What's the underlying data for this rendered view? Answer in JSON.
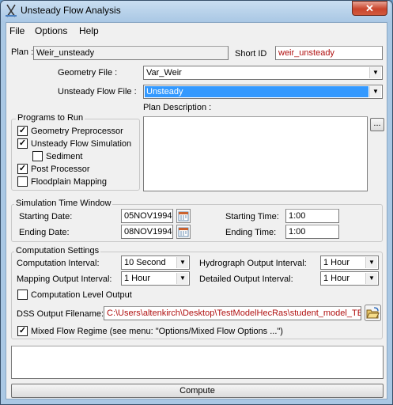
{
  "window": {
    "title": "Unsteady Flow Analysis",
    "close": "✕"
  },
  "menu": [
    "File",
    "Options",
    "Help"
  ],
  "plan": {
    "label": "Plan :",
    "value": "Weir_unsteady",
    "short_id_label": "Short ID",
    "short_id_value": "weir_unsteady"
  },
  "geometry": {
    "label": "Geometry File :",
    "value": "Var_Weir"
  },
  "unsteady_file": {
    "label": "Unsteady Flow File :",
    "value": "Unsteady"
  },
  "programs": {
    "title": "Programs to Run",
    "items": [
      {
        "label": "Geometry Preprocessor",
        "checked": true
      },
      {
        "label": "Unsteady Flow Simulation",
        "checked": true
      },
      {
        "label": "Sediment",
        "checked": false
      },
      {
        "label": "Post Processor",
        "checked": true
      },
      {
        "label": "Floodplain Mapping",
        "checked": false
      }
    ]
  },
  "plan_description": {
    "label": "Plan Description :",
    "value": "",
    "button": "..."
  },
  "sim_window": {
    "title": "Simulation Time Window",
    "start_date_label": "Starting Date:",
    "start_date": "05NOV1994",
    "end_date_label": "Ending Date:",
    "end_date": "08NOV1994",
    "start_time_label": "Starting Time:",
    "start_time": "1:00",
    "end_time_label": "Ending Time:",
    "end_time": "1:00"
  },
  "computation": {
    "title": "Computation Settings",
    "comp_interval_label": "Computation Interval:",
    "comp_interval": "10 Second",
    "hydro_interval_label": "Hydrograph Output Interval:",
    "hydro_interval": "1 Hour",
    "map_interval_label": "Mapping Output Interval:",
    "map_interval": "1 Hour",
    "detail_interval_label": "Detailed Output Interval:",
    "detail_interval": "1 Hour",
    "comp_level_label": "Computation Level Output",
    "comp_level_checked": false,
    "dss_label": "DSS Output Filename:",
    "dss_value": "C:\\Users\\altenkirch\\Desktop\\TestModelHecRas\\student_model_TES",
    "mixed_label": "Mixed Flow Regime (see menu: \"Options/Mixed Flow Options ...\")",
    "mixed_checked": true
  },
  "message_box": "",
  "compute_button": "Compute"
}
